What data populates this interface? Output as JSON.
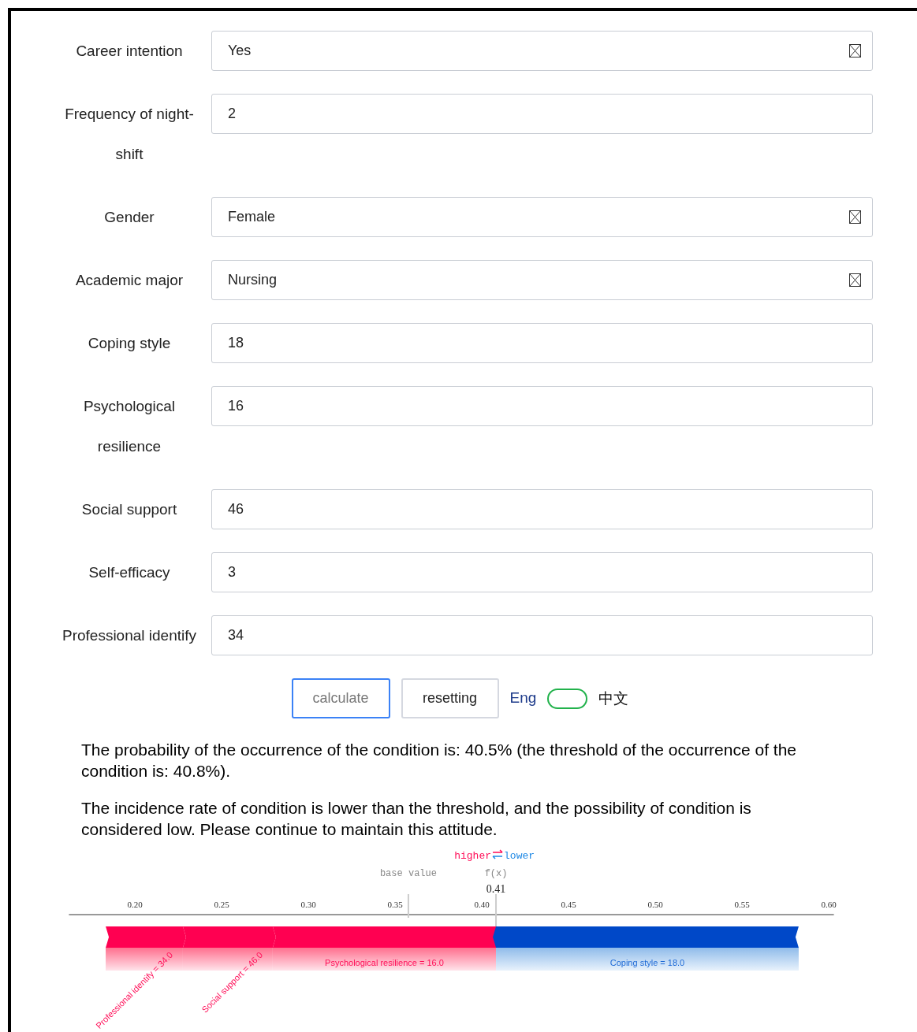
{
  "fields": [
    {
      "label": "Career intention",
      "kind": "select",
      "value": "Yes"
    },
    {
      "label": "Frequency of night-shift",
      "kind": "number",
      "value": "2"
    },
    {
      "label": "Gender",
      "kind": "select",
      "value": "Female"
    },
    {
      "label": "Academic major",
      "kind": "select",
      "value": "Nursing"
    },
    {
      "label": "Coping style",
      "kind": "number",
      "value": "18"
    },
    {
      "label": "Psychological resilience",
      "kind": "number",
      "value": "16"
    },
    {
      "label": "Social support",
      "kind": "number",
      "value": "46"
    },
    {
      "label": "Self-efficacy",
      "kind": "number",
      "value": "3"
    },
    {
      "label": "Professional identify",
      "kind": "number",
      "value": "34"
    }
  ],
  "buttons": [
    {
      "label": "calculate",
      "focused": true
    },
    {
      "label": "resetting",
      "focused": false
    }
  ],
  "language_toggle": {
    "left_label": "Eng",
    "right_label": "中文",
    "on": false
  },
  "result": [
    "The probability of the occurrence of the condition is: 40.5% (the threshold of the occurrence of the condition is: 40.8%).",
    "The incidence rate of condition is lower than the threshold, and the possibility of condition is considered low. Please continue to maintain this attitude."
  ],
  "force_plot": {
    "higher_label": "higher",
    "lower_label": "lower",
    "base_label": "base value",
    "fx_label": "f(x)",
    "fx_value": "0.41",
    "ticks": [
      "0.20",
      "0.25",
      "0.30",
      "0.35",
      "0.40",
      "0.45",
      "0.50",
      "0.55",
      "0.60"
    ],
    "features": [
      {
        "label": "Professional identify = 34.0",
        "raises": true
      },
      {
        "label": "Social support = 46.0",
        "raises": true
      },
      {
        "label": "Psychological resilience = 16.0",
        "raises": true
      },
      {
        "label": "Coping style = 18.0",
        "raises": false
      }
    ]
  }
}
